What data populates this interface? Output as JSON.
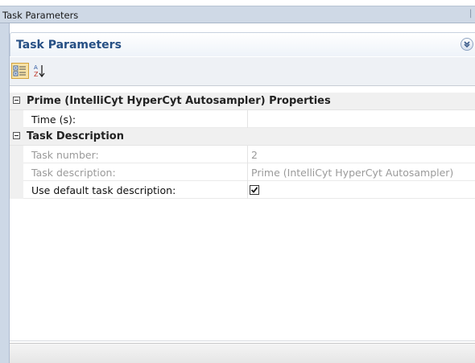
{
  "window": {
    "title": "Task Parameters"
  },
  "panel": {
    "title": "Task Parameters",
    "collapse_icon": "double-chevron-down-icon"
  },
  "toolbar": {
    "buttons": [
      {
        "name": "categorized",
        "icon": "categorized-icon",
        "active": true
      },
      {
        "name": "alphabetical",
        "icon": "sort-az-icon",
        "active": false
      }
    ]
  },
  "grid": {
    "categories": [
      {
        "label": "Prime (IntelliCyt HyperCyt Autosampler) Properties",
        "expanded": true,
        "properties": [
          {
            "name": "Time (s):",
            "value": "",
            "readonly": false
          }
        ]
      },
      {
        "label": "Task Description",
        "expanded": true,
        "properties": [
          {
            "name": "Task number:",
            "value": "2",
            "readonly": true
          },
          {
            "name": "Task description:",
            "value": "Prime (IntelliCyt HyperCyt Autosampler)",
            "readonly": true
          },
          {
            "name": "Use default task description:",
            "value": "",
            "checked": true,
            "readonly": false
          }
        ]
      }
    ]
  },
  "colors": {
    "title_bar": "#cfd9e6",
    "panel_title": "#264f84",
    "category_bg": "#f0f0f0",
    "readonly_text": "#9a9a9a"
  }
}
